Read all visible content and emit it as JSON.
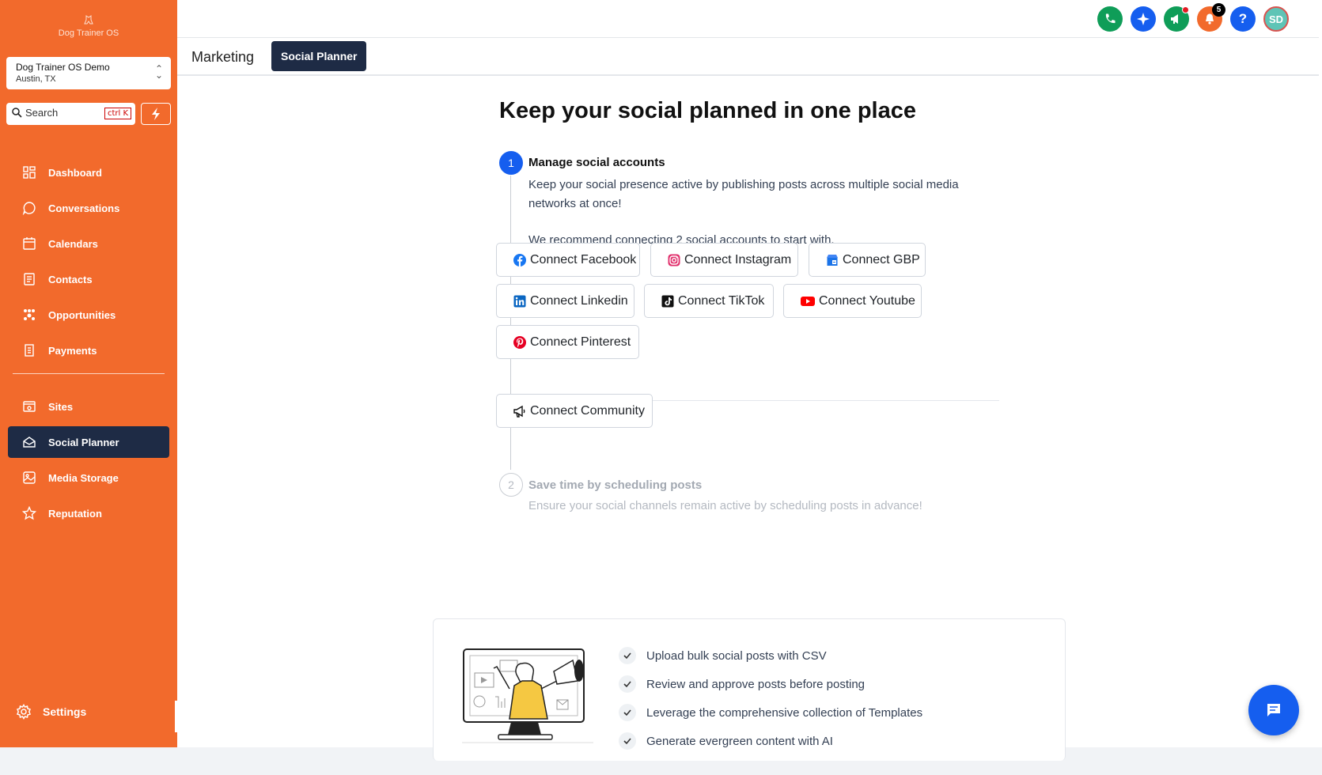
{
  "brand": {
    "name": "Dog Trainer OS"
  },
  "location": {
    "name": "Dog Trainer OS Demo",
    "city": "Austin, TX"
  },
  "search": {
    "label": "Search",
    "shortcut": "ctrl K"
  },
  "sidebar": {
    "primary": [
      {
        "label": "Dashboard",
        "icon": "dashboard-icon"
      },
      {
        "label": "Conversations",
        "icon": "chat-icon"
      },
      {
        "label": "Calendars",
        "icon": "calendar-icon"
      },
      {
        "label": "Contacts",
        "icon": "contacts-icon"
      },
      {
        "label": "Opportunities",
        "icon": "opportunities-icon"
      },
      {
        "label": "Payments",
        "icon": "payments-icon"
      }
    ],
    "secondary": [
      {
        "label": "Sites",
        "icon": "sites-icon"
      },
      {
        "label": "Social Planner",
        "icon": "social-planner-icon",
        "active": true
      },
      {
        "label": "Media Storage",
        "icon": "media-icon"
      },
      {
        "label": "Reputation",
        "icon": "star-icon"
      }
    ],
    "settings_label": "Settings"
  },
  "topbar": {
    "notifications_count": "5",
    "avatar_initials": "SD",
    "colors": {
      "phone": "#0f9d58",
      "ai": "#155eef",
      "announce": "#0f9d58",
      "alerts": "#f26a2c",
      "help": "#155eef",
      "avatar": "#5ec4b6"
    }
  },
  "subheader": {
    "section": "Marketing",
    "tab": "Social Planner"
  },
  "main": {
    "headline": "Keep your social planned in one place",
    "step1": {
      "number": "1",
      "title": "Manage social accounts",
      "description": "Keep your social presence active by publishing posts across multiple social media networks at once!",
      "recommendation": "We recommend connecting 2 social accounts to start with."
    },
    "connect_buttons": {
      "facebook": "Connect Facebook",
      "instagram": "Connect Instagram",
      "gbp": "Connect GBP",
      "linkedin": "Connect Linkedin",
      "tiktok": "Connect TikTok",
      "youtube": "Connect Youtube",
      "pinterest": "Connect Pinterest",
      "community": "Connect Community"
    },
    "step2": {
      "number": "2",
      "title": "Save time by scheduling posts",
      "description": "Ensure your social channels remain active by scheduling posts in advance!"
    },
    "features": [
      "Upload bulk social posts with CSV",
      "Review and approve posts before posting",
      "Leverage the comprehensive collection of Templates",
      "Generate evergreen content with AI"
    ]
  },
  "colors": {
    "sidebar": "#f26a2c",
    "active_nav": "#1e2b45",
    "primary": "#155eef"
  }
}
